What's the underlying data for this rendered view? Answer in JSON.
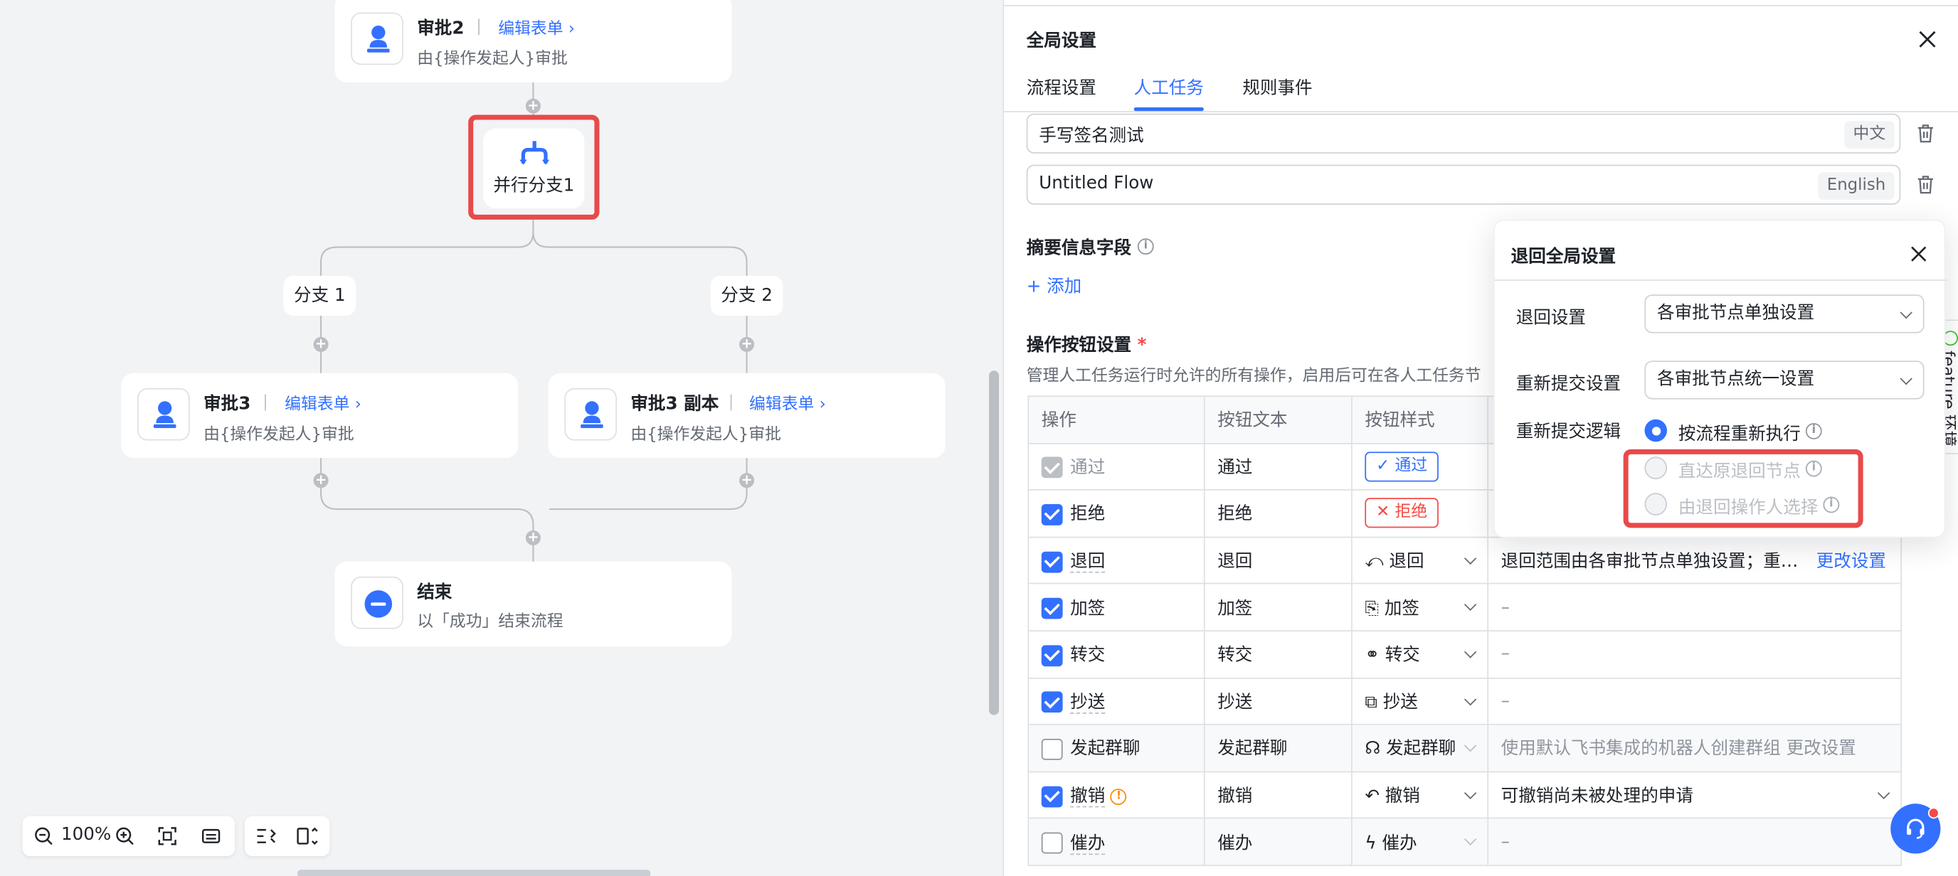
{
  "canvas": {
    "nodes": {
      "approval2": {
        "title": "审批2",
        "edit": "编辑表单",
        "subtitle": "由{操作发起人}审批"
      },
      "parallel": {
        "title": "并行分支1"
      },
      "branch1": {
        "label": "分支 1"
      },
      "branch2": {
        "label": "分支 2"
      },
      "approval3": {
        "title": "审批3",
        "edit": "编辑表单",
        "subtitle": "由{操作发起人}审批"
      },
      "approval3copy": {
        "title": "审批3 副本",
        "edit": "编辑表单",
        "subtitle": "由{操作发起人}审批"
      },
      "end": {
        "title": "结束",
        "subtitle": "以「成功」结束流程"
      }
    },
    "zoom": {
      "level": "100%"
    }
  },
  "panel": {
    "title": "全局设置",
    "tabs": [
      {
        "label": "流程设置",
        "active": false
      },
      {
        "label": "人工任务",
        "active": true
      },
      {
        "label": "规则事件",
        "active": false
      }
    ],
    "name_inputs": [
      {
        "value": "手写签名测试",
        "lang": "中文"
      },
      {
        "value": "Untitled Flow",
        "lang": "English"
      }
    ],
    "summary": {
      "label": "摘要信息字段",
      "add": "+ 添加"
    },
    "ops_section": {
      "label": "操作按钮设置",
      "required_mark": "*",
      "desc": "管理人工任务运行时允许的所有操作，启用后可在各人工任务节"
    },
    "table": {
      "headers": [
        "操作",
        "按钮文本",
        "按钮样式"
      ],
      "rows": [
        {
          "op": "通过",
          "text": "通过",
          "style": "通过",
          "note": "",
          "state": "disabled"
        },
        {
          "op": "拒绝",
          "text": "拒绝",
          "style": "拒绝",
          "note": "",
          "state": "on"
        },
        {
          "op": "退回",
          "text": "退回",
          "style": "退回",
          "note": "退回范围由各审批节点单独设置；重…",
          "link": "更改设置",
          "state": "on"
        },
        {
          "op": "加签",
          "text": "加签",
          "style": "加签",
          "note": "–",
          "state": "on"
        },
        {
          "op": "转交",
          "text": "转交",
          "style": "转交",
          "note": "–",
          "state": "on"
        },
        {
          "op": "抄送",
          "text": "抄送",
          "style": "抄送",
          "note": "–",
          "state": "on"
        },
        {
          "op": "发起群聊",
          "text": "发起群聊",
          "style": "发起群聊",
          "note": "使用默认飞书集成的机器人创建群组 更改设置",
          "state": "off"
        },
        {
          "op": "撤销",
          "text": "撤销",
          "style": "撤销",
          "note": "可撤销尚未被处理的申请",
          "state": "on"
        },
        {
          "op": "催办",
          "text": "催办",
          "style": "催办",
          "note": "–",
          "state": "off"
        }
      ]
    },
    "side_tab": "feature 环境"
  },
  "popover": {
    "title": "退回全局设置",
    "return_setting": {
      "label": "退回设置",
      "value": "各审批节点单独设置"
    },
    "resubmit_setting": {
      "label": "重新提交设置",
      "value": "各审批节点统一设置"
    },
    "resubmit_logic": {
      "label": "重新提交逻辑",
      "options": [
        {
          "label": "按流程重新执行",
          "selected": true
        },
        {
          "label": "直达原退回节点",
          "selected": false
        },
        {
          "label": "由退回操作人选择",
          "selected": false
        }
      ]
    }
  },
  "colors": {
    "accent": "#3370ff",
    "danger": "#f54a45",
    "highlight": "#e84a4a",
    "canvas_bg": "#f2f3f5"
  }
}
